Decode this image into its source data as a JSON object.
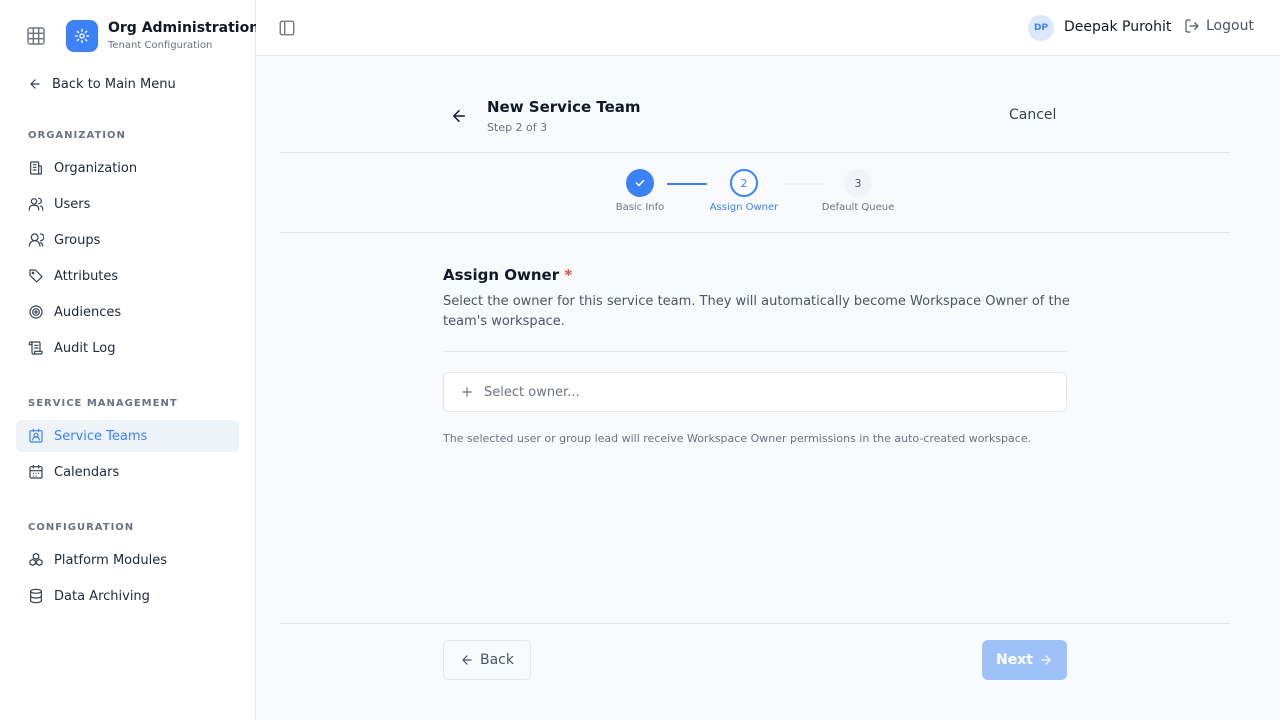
{
  "app": {
    "title": "Org Administration",
    "subtitle": "Tenant Configuration"
  },
  "sidebar": {
    "back_label": "Back to Main Menu",
    "sections": [
      {
        "label": "ORGANIZATION",
        "items": [
          {
            "label": "Organization",
            "icon": "building-icon"
          },
          {
            "label": "Users",
            "icon": "users-icon"
          },
          {
            "label": "Groups",
            "icon": "group-icon"
          },
          {
            "label": "Attributes",
            "icon": "tag-icon"
          },
          {
            "label": "Audiences",
            "icon": "target-icon"
          },
          {
            "label": "Audit Log",
            "icon": "scroll-icon"
          }
        ]
      },
      {
        "label": "SERVICE MANAGEMENT",
        "items": [
          {
            "label": "Service Teams",
            "icon": "contact-icon",
            "active": true
          },
          {
            "label": "Calendars",
            "icon": "calendar-icon"
          }
        ]
      },
      {
        "label": "CONFIGURATION",
        "items": [
          {
            "label": "Platform Modules",
            "icon": "boxes-icon"
          },
          {
            "label": "Data Archiving",
            "icon": "database-icon"
          }
        ]
      }
    ]
  },
  "header": {
    "avatar_initials": "DP",
    "user_name": "Deepak Purohit",
    "logout_label": "Logout"
  },
  "page": {
    "title": "New Service Team",
    "step_text": "Step 2 of 3",
    "cancel_label": "Cancel"
  },
  "stepper": {
    "steps": [
      {
        "number": "1",
        "label": "Basic Info",
        "state": "complete"
      },
      {
        "number": "2",
        "label": "Assign Owner",
        "state": "current"
      },
      {
        "number": "3",
        "label": "Default Queue",
        "state": "upcoming"
      }
    ]
  },
  "form": {
    "title": "Assign Owner",
    "required_mark": "*",
    "description": "Select the owner for this service team. They will automatically become Workspace Owner of the team's workspace.",
    "select_placeholder": "Select owner...",
    "help_text": "The selected user or group lead will receive Workspace Owner permissions in the auto-created workspace."
  },
  "footer": {
    "back_label": "Back",
    "next_label": "Next"
  },
  "colors": {
    "accent": "#3b82f6",
    "accent_disabled": "#9ec2f7",
    "required": "#ef4444"
  }
}
